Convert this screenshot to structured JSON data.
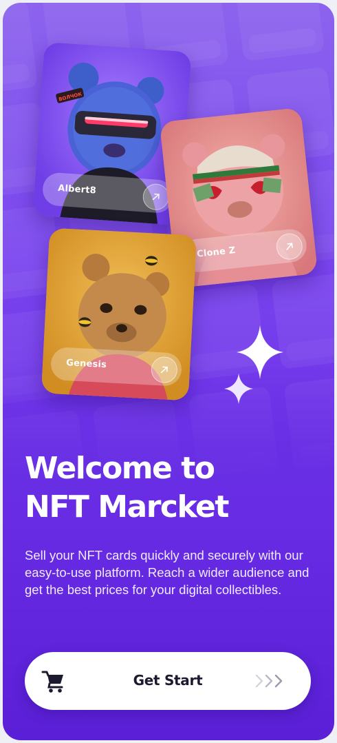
{
  "cards": [
    {
      "name": "Albert8",
      "tag": "ВОЛЧОК"
    },
    {
      "name": "Clone Z"
    },
    {
      "name": "Genesis"
    }
  ],
  "headline": {
    "line1": "Welcome to",
    "line2": "NFT Marcket"
  },
  "description": "Sell your NFT cards quickly and securely with our easy-to-use platform. Reach a wider audience and get the best prices for your digital collectibles.",
  "cta": {
    "label": "Get Start",
    "icon": "cart-icon",
    "arrows": "chevrons-right-icon"
  },
  "colors": {
    "accent": "#7c4aee",
    "background_top": "#8c63ee",
    "background_bottom": "#5a1fd6",
    "button": "#ffffff",
    "button_text": "#1c1a2e"
  }
}
